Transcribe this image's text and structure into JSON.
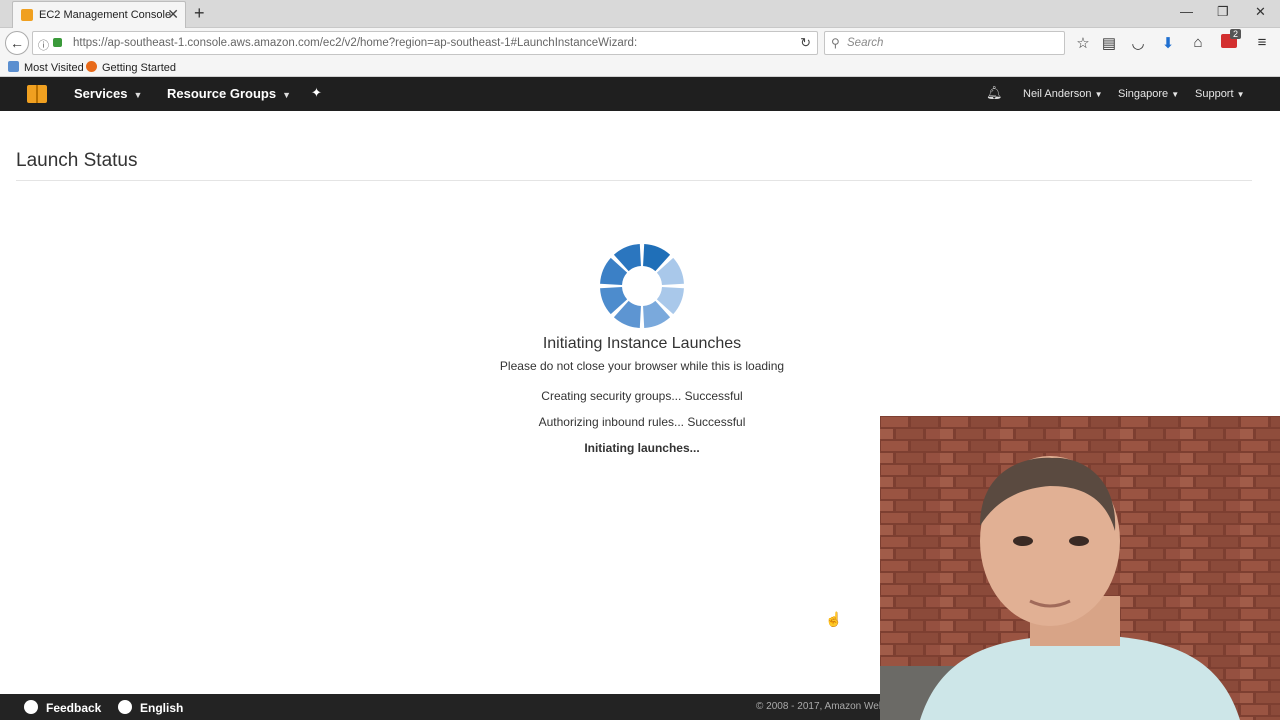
{
  "browser": {
    "tab_title": "EC2 Management Console",
    "tab_close": "✕",
    "new_tab": "+",
    "window_controls": [
      "—",
      "❐",
      "✕"
    ],
    "url": "https://ap-southeast-1.console.aws.amazon.com/ec2/v2/home?region=ap-southeast-1#LaunchInstanceWizard:",
    "search_placeholder": "Search",
    "extension_badge": "2",
    "bookmarks": [
      "Most Visited",
      "Getting Started"
    ]
  },
  "aws_nav": {
    "services": "Services",
    "resource_groups": "Resource Groups",
    "user": "Neil Anderson",
    "region": "Singapore",
    "support": "Support"
  },
  "page": {
    "title": "Launch Status",
    "heading": "Initiating Instance Launches",
    "subheading": "Please do not close your browser while this is loading",
    "steps": [
      {
        "text": "Creating security groups... Successful",
        "active": false
      },
      {
        "text": "Authorizing inbound rules... Successful",
        "active": false
      },
      {
        "text": "Initiating launches...",
        "active": true
      }
    ]
  },
  "footer": {
    "feedback": "Feedback",
    "language": "English",
    "copyright": "© 2008 - 2017, Amazon Web"
  },
  "colors": {
    "aws_nav_bg": "#1f1f1f",
    "aws_orange": "#f0a020",
    "spinner_dark": "#1f6fb8",
    "spinner_light": "#a9c8ea"
  },
  "icons": {
    "back": "arrow-left-icon",
    "reload": "reload-icon",
    "bookmark_star": "star-icon",
    "reading_list": "clipboard-icon",
    "pocket": "pocket-icon",
    "download": "download-icon",
    "home": "home-icon",
    "menu": "hamburger-menu-icon",
    "notifications": "bell-icon",
    "pin": "pin-icon",
    "feedback": "speech-bubble-icon",
    "language": "globe-icon",
    "loading": "loading-spinner-icon"
  }
}
